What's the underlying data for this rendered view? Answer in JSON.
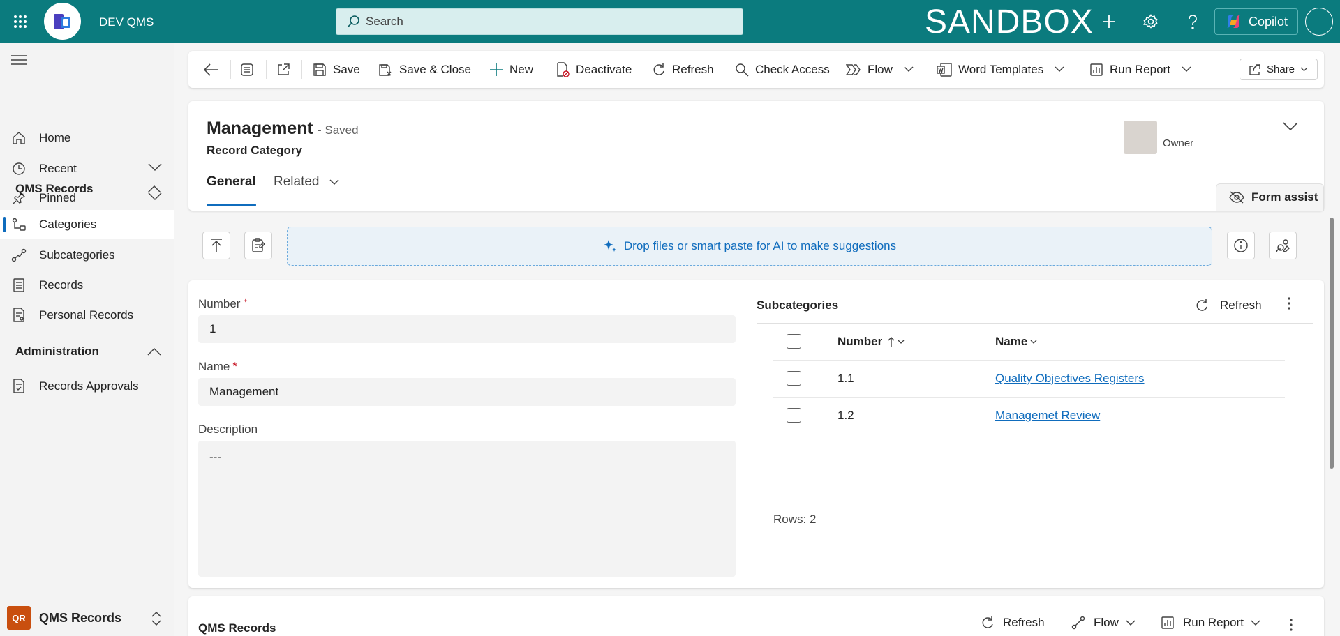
{
  "topbar": {
    "app_name": "DEV QMS",
    "search_placeholder": "Search",
    "environment_banner": "SANDBOX",
    "copilot_label": "Copilot",
    "colors": {
      "bar": "#0b7b7e"
    }
  },
  "sidebar": {
    "items_top": [
      {
        "label": "Home",
        "icon": "home-icon"
      },
      {
        "label": "Recent",
        "icon": "clock-icon"
      },
      {
        "label": "Pinned",
        "icon": "pin-icon"
      }
    ],
    "group1": "QMS Records",
    "group1_items": [
      {
        "label": "Categories",
        "icon": "categories-icon",
        "active": true
      },
      {
        "label": "Subcategories",
        "icon": "subcategories-icon"
      },
      {
        "label": "Records",
        "icon": "records-icon"
      },
      {
        "label": "Personal Records",
        "icon": "personal-records-icon"
      }
    ],
    "group2": "Administration",
    "group2_items": [
      {
        "label": "Records Approvals",
        "icon": "approvals-icon"
      }
    ],
    "area_badge": "QR",
    "area_label": "QMS Records"
  },
  "commands": {
    "save": "Save",
    "save_close": "Save & Close",
    "new": "New",
    "deactivate": "Deactivate",
    "refresh": "Refresh",
    "check_access": "Check Access",
    "flow": "Flow",
    "word_templates": "Word Templates",
    "run_report": "Run Report",
    "share": "Share"
  },
  "record": {
    "title": "Management",
    "status": "- Saved",
    "entity": "Record Category",
    "owner_label": "Owner",
    "tabs": {
      "general": "General",
      "related": "Related"
    },
    "form_assist": "Form assist"
  },
  "ai_drop": "Drop files or smart paste for AI to make suggestions",
  "form": {
    "number_label": "Number",
    "number_marker": "⁺",
    "number_value": "1",
    "name_label": "Name",
    "name_marker": "*",
    "name_value": "Management",
    "description_label": "Description",
    "description_value": "---"
  },
  "subgrid": {
    "title": "Subcategories",
    "refresh": "Refresh",
    "columns": {
      "number": "Number",
      "name": "Name"
    },
    "rows": [
      {
        "number": "1.1",
        "name": "Quality Objectives Registers"
      },
      {
        "number": "1.2",
        "name": "Managemet Review"
      }
    ],
    "rows_count": "Rows: 2"
  },
  "bottom_section": {
    "title": "QMS Records",
    "refresh": "Refresh",
    "flow": "Flow",
    "run_report": "Run Report"
  }
}
